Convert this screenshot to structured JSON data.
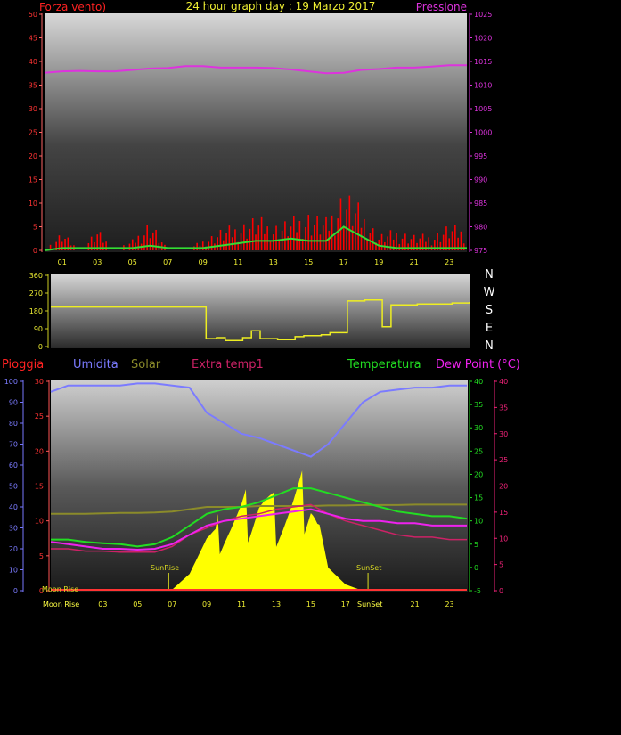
{
  "title": "24 hour graph day : 19 Marzo 2017",
  "colors": {
    "wind": "#ff1a1a",
    "gust": "#ff0000",
    "windavg": "#33dd33",
    "pressure": "#dd33dd",
    "direction": "#eeee22",
    "humidity": "#7b7bff",
    "solar": "#ffff00",
    "solarlabel": "#8b8b2a",
    "extra": "#cc2266",
    "temp": "#22dd22",
    "dew": "#ee22ee",
    "rain": "#ff3333",
    "rainaxis": "#7777ff"
  },
  "hour_ticks": [
    "01",
    "03",
    "05",
    "07",
    "09",
    "11",
    "13",
    "15",
    "17",
    "19",
    "21",
    "23"
  ],
  "chart_data": [
    {
      "type": "line",
      "id": "wind_pressure",
      "title": "24 hour graph day : 19 Marzo 2017",
      "left_label": "Forza vento)",
      "right_label": "Pressione",
      "left_ticks": [
        "0",
        "5",
        "10",
        "15",
        "20",
        "25",
        "30",
        "35",
        "40",
        "45",
        "50"
      ],
      "right_ticks": [
        "975",
        "980",
        "985",
        "990",
        "995",
        "1000",
        "1005",
        "1010",
        "1015",
        "1020",
        "1025"
      ],
      "ylim_left": [
        0,
        50
      ],
      "ylim_right": [
        975,
        1025
      ],
      "x": [
        0,
        1,
        2,
        3,
        4,
        5,
        6,
        7,
        8,
        9,
        10,
        11,
        12,
        13,
        14,
        15,
        16,
        17,
        18,
        19,
        20,
        21,
        22,
        23,
        24
      ],
      "series": [
        {
          "key": "pressure",
          "axis": "right",
          "values": [
            1012.6,
            1012.9,
            1013.0,
            1012.9,
            1012.9,
            1013.2,
            1013.5,
            1013.6,
            1014.0,
            1014.0,
            1013.7,
            1013.7,
            1013.7,
            1013.6,
            1013.3,
            1012.9,
            1012.5,
            1012.6,
            1013.2,
            1013.4,
            1013.7,
            1013.7,
            1013.9,
            1014.2,
            1014.2
          ]
        },
        {
          "key": "gust",
          "axis": "left",
          "values": [
            0,
            3.5,
            0,
            4,
            0,
            2,
            6,
            0,
            0,
            2,
            4,
            5,
            6.5,
            5,
            6,
            7.5,
            6,
            12,
            8,
            3,
            4,
            3,
            3,
            5,
            4
          ]
        },
        {
          "key": "windavg",
          "axis": "left",
          "values": [
            0,
            0.5,
            0.5,
            0.5,
            0.5,
            0.5,
            1,
            0.5,
            0.5,
            0.5,
            1,
            1.5,
            2,
            2,
            2.5,
            2,
            2,
            5,
            3,
            1,
            0.5,
            0.5,
            0.5,
            0.5,
            0.5
          ]
        }
      ]
    },
    {
      "type": "line",
      "id": "direction",
      "left_ticks": [
        "0",
        "90",
        "180",
        "270",
        "360"
      ],
      "ylim": [
        0,
        360
      ],
      "compass": [
        "N",
        "W",
        "S",
        "E",
        "N"
      ],
      "series": [
        {
          "key": "direction",
          "x": [
            0,
            8.8,
            8.9,
            9.5,
            10,
            11,
            11.5,
            12,
            13,
            14,
            14.5,
            15.5,
            16,
            17,
            18,
            19,
            19.5,
            20,
            21,
            22,
            23,
            24
          ],
          "values": [
            200,
            200,
            40,
            45,
            30,
            45,
            80,
            40,
            35,
            50,
            55,
            60,
            70,
            230,
            235,
            100,
            210,
            210,
            215,
            215,
            220,
            225
          ]
        }
      ]
    },
    {
      "type": "line",
      "id": "temp_humidity_solar",
      "legend": [
        "Pioggia",
        "Umidita",
        "Solar",
        "Extra temp1",
        "Temperatura",
        "Dew Point (°C)"
      ],
      "hum_ticks": [
        "0",
        "10",
        "20",
        "30",
        "40",
        "50",
        "60",
        "70",
        "80",
        "90",
        "100"
      ],
      "rain_ticks": [
        "0",
        "5",
        "10",
        "15",
        "20",
        "25",
        "30"
      ],
      "temp_ticks": [
        "-5",
        "0",
        "5",
        "10",
        "15",
        "20",
        "25",
        "30",
        "35",
        "40"
      ],
      "dew_ticks": [
        "0",
        "5",
        "10",
        "15",
        "20",
        "25",
        "30",
        "35",
        "40"
      ],
      "ylim_humidity": [
        0,
        100
      ],
      "ylim_temp": [
        -5,
        40
      ],
      "annotations": [
        "SunRise",
        "SunSet",
        "Moon Rise",
        "Moon Rise",
        "SunSet"
      ],
      "x": [
        0,
        1,
        2,
        3,
        4,
        5,
        6,
        7,
        8,
        9,
        10,
        11,
        12,
        13,
        14,
        15,
        16,
        17,
        18,
        19,
        20,
        21,
        22,
        23,
        24
      ],
      "series": [
        {
          "key": "humidity",
          "axis": "humidity",
          "values": [
            95,
            98,
            98,
            98,
            98,
            99,
            99,
            98,
            97,
            85,
            80,
            75,
            73,
            70,
            67,
            64,
            70,
            80,
            90,
            95,
            96,
            97,
            97,
            98,
            98
          ]
        },
        {
          "key": "temp",
          "axis": "temp",
          "values": [
            6,
            6,
            5.5,
            5.2,
            5.0,
            4.5,
            5.0,
            6.5,
            9,
            11.5,
            12.5,
            13,
            14,
            15.5,
            17,
            17,
            16,
            15,
            14,
            13,
            12,
            11.5,
            11,
            11,
            10.5
          ]
        },
        {
          "key": "dew",
          "axis": "temp",
          "values": [
            5.5,
            5,
            4.5,
            4.0,
            4.0,
            3.8,
            4.0,
            5.0,
            7.0,
            9.0,
            10.0,
            10.5,
            11,
            11.5,
            12,
            12.5,
            11.5,
            10.5,
            10,
            10,
            9.5,
            9.5,
            9,
            9,
            9
          ]
        },
        {
          "key": "extra",
          "axis": "temp",
          "values": [
            4,
            4,
            3.5,
            3.5,
            3.3,
            3.3,
            3.3,
            4.5,
            7.0,
            8.5,
            10,
            11,
            11.5,
            12.5,
            13,
            13.5,
            11.5,
            10,
            9,
            8,
            7,
            6.5,
            6.5,
            6,
            6
          ]
        },
        {
          "key": "solar_level",
          "axis": "temp",
          "values": [
            11.5,
            11.5,
            11.5,
            11.6,
            11.7,
            11.7,
            11.8,
            12,
            12.5,
            13,
            13,
            13,
            13.2,
            13.2,
            13.2,
            13.2,
            13.3,
            13.3,
            13.4,
            13.4,
            13.4,
            13.5,
            13.5,
            13.5,
            13.5
          ]
        },
        {
          "key": "solar",
          "axis": "humidity",
          "values": [
            0,
            0,
            0,
            0,
            0,
            0,
            0,
            0.5,
            8,
            25,
            34,
            38,
            48,
            38,
            44,
            52,
            11,
            3,
            0,
            0,
            0,
            0,
            0,
            0,
            0
          ]
        }
      ]
    }
  ]
}
